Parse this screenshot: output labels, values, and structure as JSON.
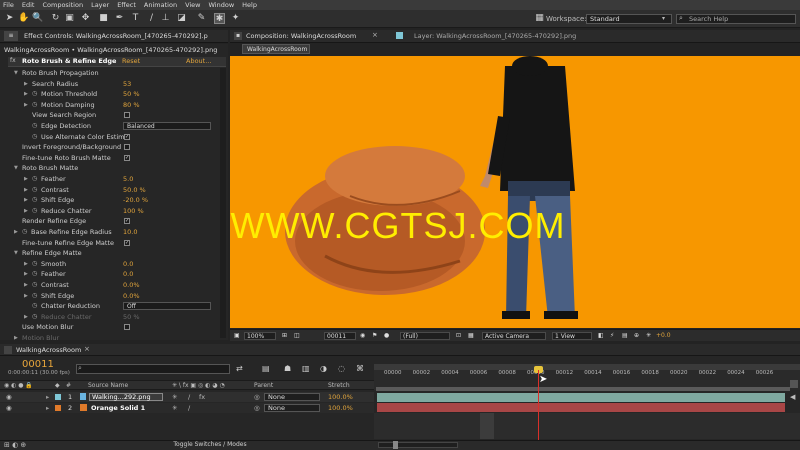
{
  "menu": [
    "File",
    "Edit",
    "Composition",
    "Layer",
    "Effect",
    "Animation",
    "View",
    "Window",
    "Help"
  ],
  "toolbar": {
    "workspace_label": "Workspace:",
    "workspace_value": "Standard",
    "search_placeholder": "Search Help"
  },
  "effects_panel": {
    "tab_label": "Effect Controls: WalkingAcrossRoom_[470265-470292].p",
    "subtitle": "WalkingAcrossRoom • WalkingAcrossRoom_[470265-470292].png",
    "effect_name": "Roto Brush & Refine Edge",
    "reset_label": "Reset",
    "about_label": "About...",
    "rows": [
      {
        "label": "Roto Brush Propagation",
        "indent": 1,
        "twirl": "open"
      },
      {
        "label": "Search Radius",
        "indent": 2,
        "twirl": "closed",
        "value": "53"
      },
      {
        "label": "Motion Threshold",
        "indent": 2,
        "twirl": "closed",
        "stopwatch": true,
        "value": "50 %"
      },
      {
        "label": "Motion Damping",
        "indent": 2,
        "twirl": "closed",
        "stopwatch": true,
        "value": "80 %"
      },
      {
        "label": "View Search Region",
        "indent": 2,
        "check": ""
      },
      {
        "label": "Edge Detection",
        "indent": 2,
        "stopwatch": true,
        "dropdown": "Balanced"
      },
      {
        "label": "Use Alternate Color Estim",
        "indent": 2,
        "stopwatch": true,
        "check": "✓"
      },
      {
        "label": "Invert Foreground/Background",
        "indent": 1,
        "check": ""
      },
      {
        "label": "Fine-tune Roto Brush Matte",
        "indent": 1,
        "check": "✓"
      },
      {
        "label": "Roto Brush Matte",
        "indent": 1,
        "twirl": "open"
      },
      {
        "label": "Feather",
        "indent": 2,
        "twirl": "closed",
        "stopwatch": true,
        "value": "5.0"
      },
      {
        "label": "Contrast",
        "indent": 2,
        "twirl": "closed",
        "stopwatch": true,
        "value": "50.0 %"
      },
      {
        "label": "Shift Edge",
        "indent": 2,
        "twirl": "closed",
        "stopwatch": true,
        "value": "-20.0 %"
      },
      {
        "label": "Reduce Chatter",
        "indent": 2,
        "twirl": "closed",
        "stopwatch": true,
        "value": "100 %"
      },
      {
        "label": "Render Refine Edge",
        "indent": 1,
        "check": "✓"
      },
      {
        "label": "Base Refine Edge Radius",
        "indent": 1,
        "twirl": "closed",
        "stopwatch": true,
        "value": "10.0"
      },
      {
        "label": "Fine-tune Refine Edge Matte",
        "indent": 1,
        "check": "✓"
      },
      {
        "label": "Refine Edge Matte",
        "indent": 1,
        "twirl": "open"
      },
      {
        "label": "Smooth",
        "indent": 2,
        "twirl": "closed",
        "stopwatch": true,
        "value": "0.0"
      },
      {
        "label": "Feather",
        "indent": 2,
        "twirl": "closed",
        "stopwatch": true,
        "value": "0.0"
      },
      {
        "label": "Contrast",
        "indent": 2,
        "twirl": "closed",
        "stopwatch": true,
        "value": "0.0%"
      },
      {
        "label": "Shift Edge",
        "indent": 2,
        "twirl": "closed",
        "stopwatch": true,
        "value": "0.0%"
      },
      {
        "label": "Chatter Reduction",
        "indent": 2,
        "stopwatch": true,
        "dropdown": "Off"
      },
      {
        "label": "Reduce Chatter",
        "indent": 2,
        "twirl": "closed",
        "stopwatch": true,
        "value": "50 %",
        "disabled": true
      },
      {
        "label": "Use Motion Blur",
        "indent": 1,
        "check": ""
      },
      {
        "label": "Motion Blur",
        "indent": 1,
        "twirl": "closed",
        "disabled": true
      }
    ]
  },
  "composition": {
    "tab_label": "Composition: WalkingAcrossRoom",
    "layer_tab_label": "Layer: WalkingAcrossRoom_[470265-470292].png",
    "chip_label": "WalkingAcrossRoom",
    "watermark": "WWW.CGTSJ.COM",
    "background_color": "#f79700",
    "viewer_bar": {
      "zoom": "100%",
      "timecode": "00011",
      "resolution": "(Full)",
      "camera": "Active Camera",
      "views": "1 View",
      "exposure": "+0.0"
    }
  },
  "timeline": {
    "tab_label": "WalkingAcrossRoom",
    "timecode": "00011",
    "timecode_sub": "0:00:00:11 (30.00 fps)",
    "columns": {
      "source": "Source Name",
      "parent": "Parent",
      "stretch": "Stretch"
    },
    "ruler_ticks": [
      "00000",
      "00002",
      "00004",
      "00006",
      "00008",
      "00010",
      "00012",
      "00014",
      "00016",
      "00018",
      "00020",
      "00022",
      "00024",
      "00026"
    ],
    "playhead_frame": 11,
    "layers": [
      {
        "num": "1",
        "name": "Walking...292.png",
        "color": "#7fc7d6",
        "parent": "None",
        "stretch": "100.0%",
        "bar_color": "#7fa9a0"
      },
      {
        "num": "2",
        "name": "Orange Solid 1",
        "color": "#e07a2a",
        "parent": "None",
        "stretch": "100.0%",
        "bar_color": "#a84646"
      }
    ],
    "toggle_label": "Toggle Switches / Modes"
  }
}
